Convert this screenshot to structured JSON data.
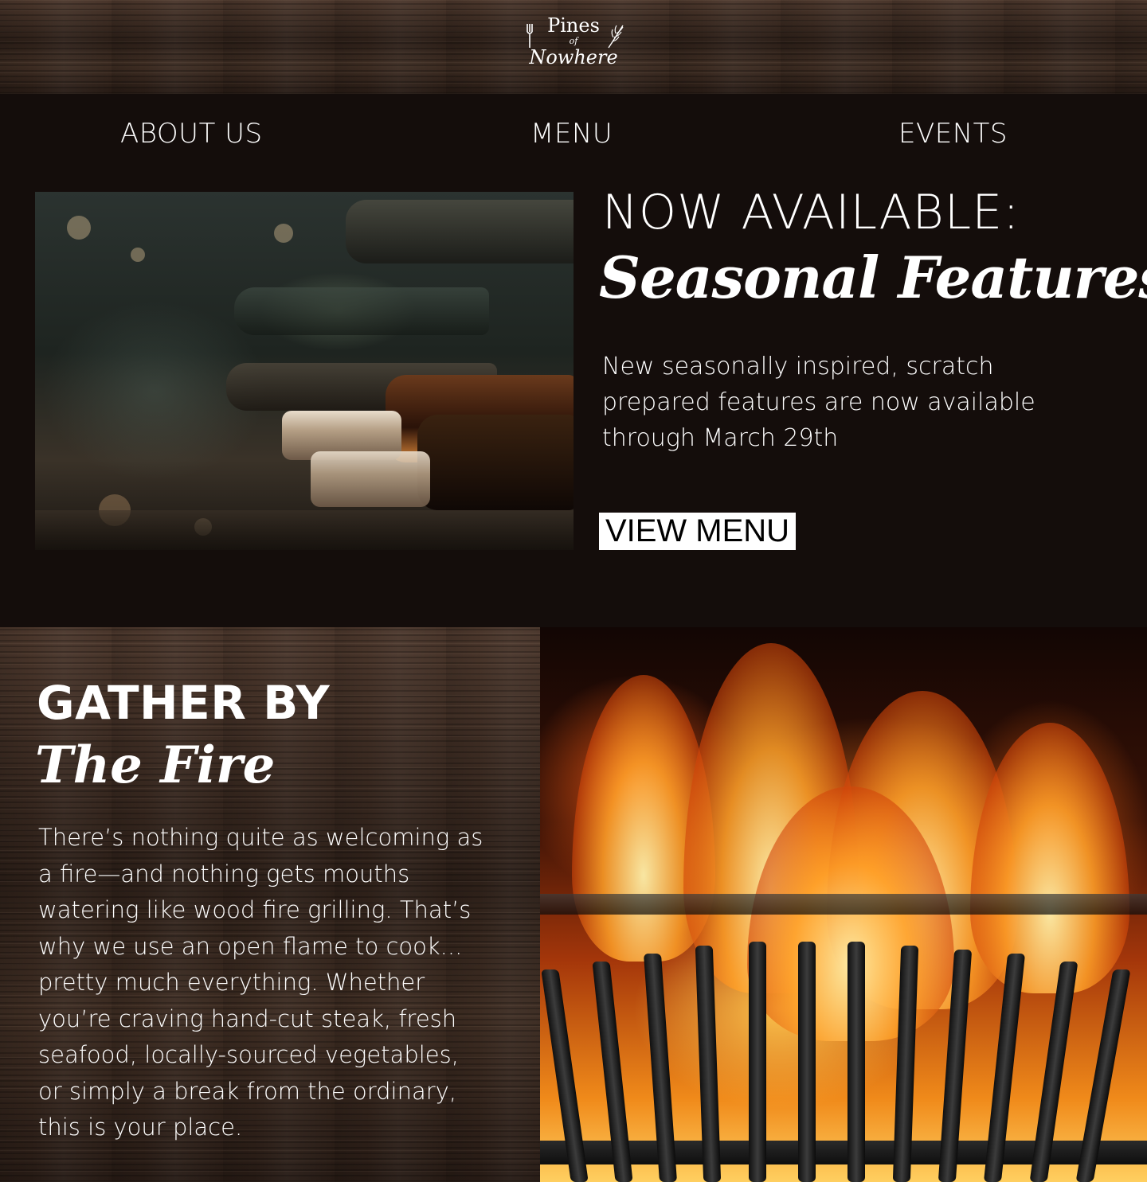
{
  "header": {
    "logo": {
      "line1": "Pines",
      "line2": "of",
      "line3": "Nowhere"
    }
  },
  "nav": {
    "items": [
      {
        "label": "ABOUT US"
      },
      {
        "label": "MENU"
      },
      {
        "label": "EVENTS"
      }
    ]
  },
  "hero": {
    "title": "NOW AVAILABLE:",
    "script_title": "Seasonal Features",
    "description": "New seasonally inspired, scratch prepared features are now available through March 29th",
    "button_label": "VIEW MENU"
  },
  "fire_section": {
    "title": "GATHER BY",
    "script_title": "The Fire",
    "description": "There’s nothing quite as welcoming as a fire—and nothing gets mouths watering like wood fire grilling. That’s why we use an open flame to cook... pretty much everything. Whether you’re craving hand-cut steak, fresh seafood, locally-sourced vegetables, or simply a break from the ordinary, this is your place."
  },
  "colors": {
    "background": "#140d0b",
    "text": "#ffffff",
    "button_bg": "#ffffff",
    "button_text": "#000000"
  }
}
